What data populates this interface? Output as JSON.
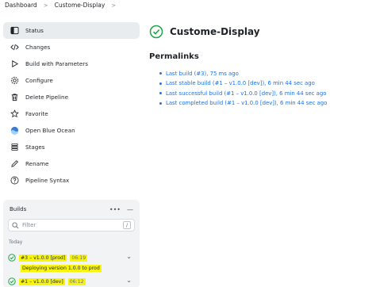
{
  "breadcrumb": [
    "Dashboard",
    "Custome-Display"
  ],
  "sidebar": {
    "items": [
      {
        "label": "Status",
        "icon": "status-icon"
      },
      {
        "label": "Changes",
        "icon": "code-icon"
      },
      {
        "label": "Build with Parameters",
        "icon": "play-icon"
      },
      {
        "label": "Configure",
        "icon": "gear-icon"
      },
      {
        "label": "Delete Pipeline",
        "icon": "trash-icon"
      },
      {
        "label": "Favorite",
        "icon": "star-icon"
      },
      {
        "label": "Open Blue Ocean",
        "icon": "blue-ocean-icon"
      },
      {
        "label": "Stages",
        "icon": "stages-icon"
      },
      {
        "label": "Rename",
        "icon": "pencil-icon"
      },
      {
        "label": "Pipeline Syntax",
        "icon": "help-icon"
      }
    ]
  },
  "builds": {
    "title": "Builds",
    "filter_placeholder": "Filter",
    "shortcut": "/",
    "group": "Today",
    "rows": [
      {
        "name": "#3 – v1.0.0 [prod]",
        "time": "06:19",
        "message": "Deploying version 1.0.0 to prod"
      },
      {
        "name": "#1 – v1.0.0 [dev]",
        "time": "06:12"
      }
    ]
  },
  "main": {
    "title": "Custome-Display",
    "permalinks_heading": "Permalinks",
    "permalinks": [
      "Last build (#3), 75 ms ago",
      "Last stable build (#1 – v1.0.0 [dev]), 6 min 44 sec ago",
      "Last successful build (#1 – v1.0.0 [dev]), 6 min 44 sec ago",
      "Last completed build (#1 – v1.0.0 [dev]), 6 min 44 sec ago"
    ]
  },
  "colors": {
    "success": "#1ea446",
    "link": "#1a73e8",
    "highlight": "#f8f50a",
    "active_bg": "#e9ecef"
  }
}
